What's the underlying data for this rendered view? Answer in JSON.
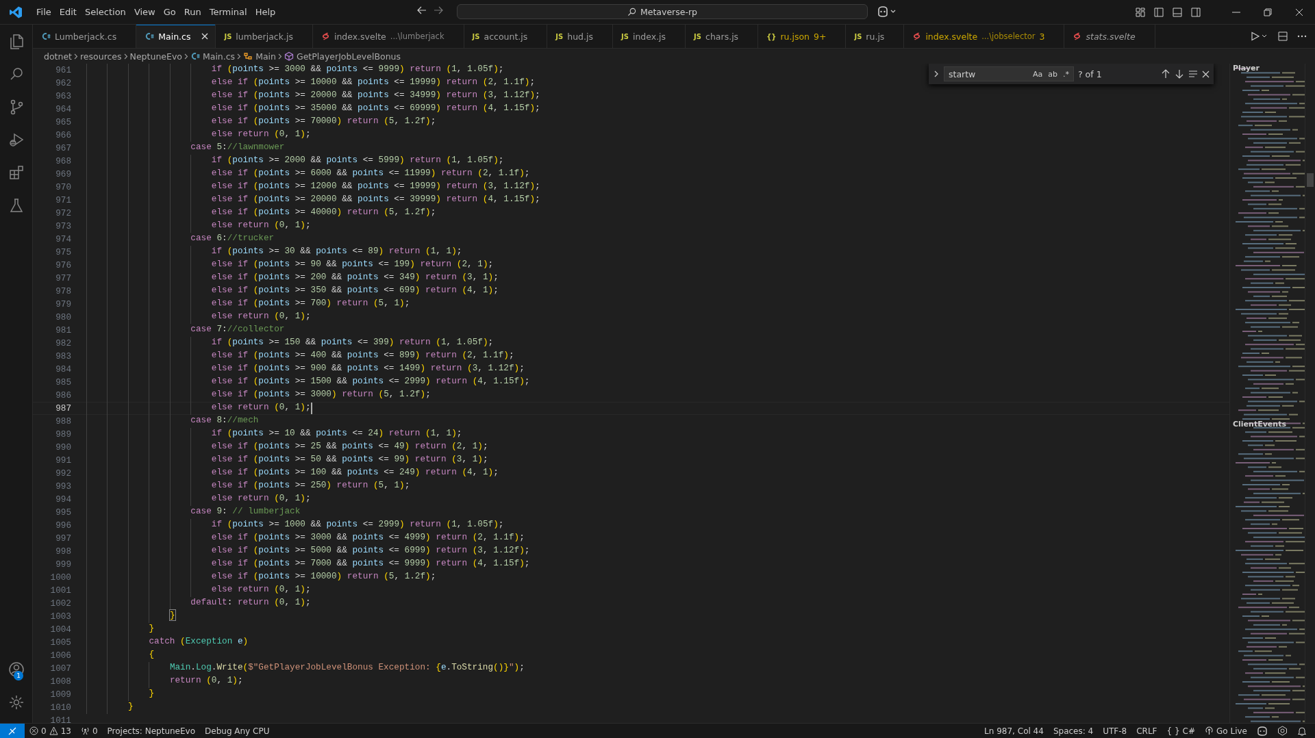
{
  "menu": [
    "File",
    "Edit",
    "Selection",
    "View",
    "Go",
    "Run",
    "Terminal",
    "Help"
  ],
  "command_center": {
    "text": "Metaverse-rp"
  },
  "activity_bar": {
    "items": [
      {
        "kind": "explorer"
      },
      {
        "kind": "search"
      },
      {
        "kind": "source-control"
      },
      {
        "kind": "run-debug"
      },
      {
        "kind": "extensions"
      },
      {
        "kind": "testing"
      }
    ],
    "account_badge": "1"
  },
  "tabs": [
    {
      "kind": "cs",
      "label": "Lumberjack.cs",
      "selected": false,
      "warning": false,
      "preview": false
    },
    {
      "kind": "cs",
      "label": "Main.cs",
      "selected": true,
      "warning": false,
      "preview": false
    },
    {
      "kind": "js",
      "icon_text": "JS",
      "label": "lumberjack.js",
      "selected": false,
      "warning": false,
      "preview": false
    },
    {
      "kind": "svelte",
      "label": "index.svelte",
      "description": "...\\lumberjack",
      "selected": false,
      "warning": false,
      "preview": false
    },
    {
      "kind": "js",
      "icon_text": "JS",
      "label": "account.js",
      "selected": false,
      "warning": false,
      "preview": false
    },
    {
      "kind": "js",
      "icon_text": "JS",
      "label": "hud.js",
      "selected": false,
      "warning": false,
      "preview": false
    },
    {
      "kind": "js",
      "icon_text": "JS",
      "label": "index.js",
      "selected": false,
      "warning": false,
      "preview": false
    },
    {
      "kind": "js",
      "icon_text": "JS",
      "label": "chars.js",
      "selected": false,
      "warning": false,
      "preview": false
    },
    {
      "kind": "json",
      "icon_text": "{}",
      "label": "ru.json",
      "badge": "9+",
      "selected": false,
      "warning": true,
      "preview": false
    },
    {
      "kind": "js",
      "icon_text": "JS",
      "label": "ru.js",
      "selected": false,
      "warning": false,
      "preview": false
    },
    {
      "kind": "svelte",
      "label": "index.svelte",
      "description": "...\\jobselector",
      "badge": "3",
      "selected": false,
      "warning": true,
      "preview": false
    },
    {
      "kind": "svelte",
      "label": "stats.svelte",
      "selected": false,
      "warning": false,
      "preview": true
    }
  ],
  "breadcrumb": [
    {
      "kind": "folder",
      "label": "dotnet"
    },
    {
      "kind": "folder",
      "label": "resources"
    },
    {
      "kind": "folder",
      "label": "NeptuneEvo"
    },
    {
      "kind": "cs",
      "label": "Main.cs"
    },
    {
      "kind": "class",
      "label": "Main"
    },
    {
      "kind": "method",
      "label": "GetPlayerJobLevelBonus"
    }
  ],
  "find": {
    "value": "startw",
    "options": [
      {
        "label": "Aa",
        "selected": false
      },
      {
        "label": "ab",
        "selected": false
      },
      {
        "label": ".*",
        "selected": false
      }
    ],
    "result": "? of 1"
  },
  "editor": {
    "lines": [
      {
        "number": "961",
        "current": false,
        "segments": [
          {
            "kind": "keyword",
            "text": "                        if"
          },
          {
            "kind": "plain",
            "text": " ("
          },
          {
            "kind": "variable",
            "text": "points"
          },
          {
            "kind": "plain",
            "text": " >= 3000 && "
          },
          {
            "kind": "variable",
            "text": "points"
          },
          {
            "kind": "plain",
            "text": " <= 9999) "
          },
          {
            "kind": "keyword",
            "text": "return"
          },
          {
            "kind": "plain",
            "text": " (1, 1.05f);"
          }
        ]
      },
      {
        "number": "962",
        "current": false,
        "segments": [
          {
            "kind": "keyword",
            "text": "                        else if"
          },
          {
            "kind": "plain",
            "text": " ("
          },
          {
            "kind": "variable",
            "text": "points"
          },
          {
            "kind": "plain",
            "text": " >= 10000 && "
          },
          {
            "kind": "variable",
            "text": "points"
          },
          {
            "kind": "plain",
            "text": " <= 19999) "
          },
          {
            "kind": "keyword",
            "text": "return"
          },
          {
            "kind": "plain",
            "text": " (2, 1.1f);"
          }
        ]
      },
      {
        "number": "963",
        "current": false,
        "segments": [
          {
            "kind": "keyword",
            "text": "                        else if"
          },
          {
            "kind": "plain",
            "text": " ("
          },
          {
            "kind": "variable",
            "text": "points"
          },
          {
            "kind": "plain",
            "text": " >= 20000 && "
          },
          {
            "kind": "variable",
            "text": "points"
          },
          {
            "kind": "plain",
            "text": " <= 34999) "
          },
          {
            "kind": "keyword",
            "text": "return"
          },
          {
            "kind": "plain",
            "text": " (3, 1.12f);"
          }
        ]
      },
      {
        "number": "964",
        "current": false,
        "segments": [
          {
            "kind": "keyword",
            "text": "                        else if"
          },
          {
            "kind": "plain",
            "text": " ("
          },
          {
            "kind": "variable",
            "text": "points"
          },
          {
            "kind": "plain",
            "text": " >= 35000 && "
          },
          {
            "kind": "variable",
            "text": "points"
          },
          {
            "kind": "plain",
            "text": " <= 69999) "
          },
          {
            "kind": "keyword",
            "text": "return"
          },
          {
            "kind": "plain",
            "text": " (4, 1.15f);"
          }
        ]
      },
      {
        "number": "965",
        "current": false,
        "segments": [
          {
            "kind": "keyword",
            "text": "                        else if"
          },
          {
            "kind": "plain",
            "text": " ("
          },
          {
            "kind": "variable",
            "text": "points"
          },
          {
            "kind": "plain",
            "text": " >= 70000) "
          },
          {
            "kind": "keyword",
            "text": "return"
          },
          {
            "kind": "plain",
            "text": " (5, 1.2f);"
          }
        ]
      },
      {
        "number": "966",
        "current": false,
        "segments": [
          {
            "kind": "keyword",
            "text": "                        else return"
          },
          {
            "kind": "plain",
            "text": " (0, 1);"
          }
        ]
      },
      {
        "number": "967",
        "current": false,
        "segments": [
          {
            "kind": "keyword",
            "text": "                    case"
          },
          {
            "kind": "plain",
            "text": " 5:"
          },
          {
            "kind": "comment",
            "text": "//lawnmower"
          }
        ]
      },
      {
        "number": "968",
        "current": false,
        "segments": [
          {
            "kind": "keyword",
            "text": "                        if"
          },
          {
            "kind": "plain",
            "text": " ("
          },
          {
            "kind": "variable",
            "text": "points"
          },
          {
            "kind": "plain",
            "text": " >= 2000 && "
          },
          {
            "kind": "variable",
            "text": "points"
          },
          {
            "kind": "plain",
            "text": " <= 5999) "
          },
          {
            "kind": "keyword",
            "text": "return"
          },
          {
            "kind": "plain",
            "text": " (1, 1.05f);"
          }
        ]
      },
      {
        "number": "969",
        "current": false,
        "segments": [
          {
            "kind": "keyword",
            "text": "                        else if"
          },
          {
            "kind": "plain",
            "text": " ("
          },
          {
            "kind": "variable",
            "text": "points"
          },
          {
            "kind": "plain",
            "text": " >= 6000 && "
          },
          {
            "kind": "variable",
            "text": "points"
          },
          {
            "kind": "plain",
            "text": " <= 11999) "
          },
          {
            "kind": "keyword",
            "text": "return"
          },
          {
            "kind": "plain",
            "text": " (2, 1.1f);"
          }
        ]
      },
      {
        "number": "970",
        "current": false,
        "segments": [
          {
            "kind": "keyword",
            "text": "                        else if"
          },
          {
            "kind": "plain",
            "text": " ("
          },
          {
            "kind": "variable",
            "text": "points"
          },
          {
            "kind": "plain",
            "text": " >= 12000 && "
          },
          {
            "kind": "variable",
            "text": "points"
          },
          {
            "kind": "plain",
            "text": " <= 19999) "
          },
          {
            "kind": "keyword",
            "text": "return"
          },
          {
            "kind": "plain",
            "text": " (3, 1.12f);"
          }
        ]
      },
      {
        "number": "971",
        "current": false,
        "segments": [
          {
            "kind": "keyword",
            "text": "                        else if"
          },
          {
            "kind": "plain",
            "text": " ("
          },
          {
            "kind": "variable",
            "text": "points"
          },
          {
            "kind": "plain",
            "text": " >= 20000 && "
          },
          {
            "kind": "variable",
            "text": "points"
          },
          {
            "kind": "plain",
            "text": " <= 39999) "
          },
          {
            "kind": "keyword",
            "text": "return"
          },
          {
            "kind": "plain",
            "text": " (4, 1.15f);"
          }
        ]
      },
      {
        "number": "972",
        "current": false,
        "segments": [
          {
            "kind": "keyword",
            "text": "                        else if"
          },
          {
            "kind": "plain",
            "text": " ("
          },
          {
            "kind": "variable",
            "text": "points"
          },
          {
            "kind": "plain",
            "text": " >= 40000) "
          },
          {
            "kind": "keyword",
            "text": "return"
          },
          {
            "kind": "plain",
            "text": " (5, 1.2f);"
          }
        ]
      },
      {
        "number": "973",
        "current": false,
        "segments": [
          {
            "kind": "keyword",
            "text": "                        else return"
          },
          {
            "kind": "plain",
            "text": " (0, 1);"
          }
        ]
      },
      {
        "number": "974",
        "current": false,
        "segments": [
          {
            "kind": "keyword",
            "text": "                    case"
          },
          {
            "kind": "plain",
            "text": " 6:"
          },
          {
            "kind": "comment",
            "text": "//trucker"
          }
        ]
      },
      {
        "number": "975",
        "current": false,
        "segments": [
          {
            "kind": "keyword",
            "text": "                        if"
          },
          {
            "kind": "plain",
            "text": " ("
          },
          {
            "kind": "variable",
            "text": "points"
          },
          {
            "kind": "plain",
            "text": " >= 30 && "
          },
          {
            "kind": "variable",
            "text": "points"
          },
          {
            "kind": "plain",
            "text": " <= 89) "
          },
          {
            "kind": "keyword",
            "text": "return"
          },
          {
            "kind": "plain",
            "text": " (1, 1);"
          }
        ]
      },
      {
        "number": "976",
        "current": false,
        "segments": [
          {
            "kind": "keyword",
            "text": "                        else if"
          },
          {
            "kind": "plain",
            "text": " ("
          },
          {
            "kind": "variable",
            "text": "points"
          },
          {
            "kind": "plain",
            "text": " >= 90 && "
          },
          {
            "kind": "variable",
            "text": "points"
          },
          {
            "kind": "plain",
            "text": " <= 199) "
          },
          {
            "kind": "keyword",
            "text": "return"
          },
          {
            "kind": "plain",
            "text": " (2, 1);"
          }
        ]
      },
      {
        "number": "977",
        "current": false,
        "segments": [
          {
            "kind": "keyword",
            "text": "                        else if"
          },
          {
            "kind": "plain",
            "text": " ("
          },
          {
            "kind": "variable",
            "text": "points"
          },
          {
            "kind": "plain",
            "text": " >= 200 && "
          },
          {
            "kind": "variable",
            "text": "points"
          },
          {
            "kind": "plain",
            "text": " <= 349) "
          },
          {
            "kind": "keyword",
            "text": "return"
          },
          {
            "kind": "plain",
            "text": " (3, 1);"
          }
        ]
      },
      {
        "number": "978",
        "current": false,
        "segments": [
          {
            "kind": "keyword",
            "text": "                        else if"
          },
          {
            "kind": "plain",
            "text": " ("
          },
          {
            "kind": "variable",
            "text": "points"
          },
          {
            "kind": "plain",
            "text": " >= 350 && "
          },
          {
            "kind": "variable",
            "text": "points"
          },
          {
            "kind": "plain",
            "text": " <= 699) "
          },
          {
            "kind": "keyword",
            "text": "return"
          },
          {
            "kind": "plain",
            "text": " (4, 1);"
          }
        ]
      },
      {
        "number": "979",
        "current": false,
        "segments": [
          {
            "kind": "keyword",
            "text": "                        else if"
          },
          {
            "kind": "plain",
            "text": " ("
          },
          {
            "kind": "variable",
            "text": "points"
          },
          {
            "kind": "plain",
            "text": " >= 700) "
          },
          {
            "kind": "keyword",
            "text": "return"
          },
          {
            "kind": "plain",
            "text": " (5, 1);"
          }
        ]
      },
      {
        "number": "980",
        "current": false,
        "segments": [
          {
            "kind": "keyword",
            "text": "                        else return"
          },
          {
            "kind": "plain",
            "text": " (0, 1);"
          }
        ]
      },
      {
        "number": "981",
        "current": false,
        "segments": [
          {
            "kind": "keyword",
            "text": "                    case"
          },
          {
            "kind": "plain",
            "text": " 7:"
          },
          {
            "kind": "comment",
            "text": "//collector"
          }
        ]
      },
      {
        "number": "982",
        "current": false,
        "segments": [
          {
            "kind": "keyword",
            "text": "                        if"
          },
          {
            "kind": "plain",
            "text": " ("
          },
          {
            "kind": "variable",
            "text": "points"
          },
          {
            "kind": "plain",
            "text": " >= 150 && "
          },
          {
            "kind": "variable",
            "text": "points"
          },
          {
            "kind": "plain",
            "text": " <= 399) "
          },
          {
            "kind": "keyword",
            "text": "return"
          },
          {
            "kind": "plain",
            "text": " (1, 1.05f);"
          }
        ]
      },
      {
        "number": "983",
        "current": false,
        "segments": [
          {
            "kind": "keyword",
            "text": "                        else if"
          },
          {
            "kind": "plain",
            "text": " ("
          },
          {
            "kind": "variable",
            "text": "points"
          },
          {
            "kind": "plain",
            "text": " >= 400 && "
          },
          {
            "kind": "variable",
            "text": "points"
          },
          {
            "kind": "plain",
            "text": " <= 899) "
          },
          {
            "kind": "keyword",
            "text": "return"
          },
          {
            "kind": "plain",
            "text": " (2, 1.1f);"
          }
        ]
      },
      {
        "number": "984",
        "current": false,
        "segments": [
          {
            "kind": "keyword",
            "text": "                        else if"
          },
          {
            "kind": "plain",
            "text": " ("
          },
          {
            "kind": "variable",
            "text": "points"
          },
          {
            "kind": "plain",
            "text": " >= 900 && "
          },
          {
            "kind": "variable",
            "text": "points"
          },
          {
            "kind": "plain",
            "text": " <= 1499) "
          },
          {
            "kind": "keyword",
            "text": "return"
          },
          {
            "kind": "plain",
            "text": " (3, 1.12f);"
          }
        ]
      },
      {
        "number": "985",
        "current": false,
        "segments": [
          {
            "kind": "keyword",
            "text": "                        else if"
          },
          {
            "kind": "plain",
            "text": " ("
          },
          {
            "kind": "variable",
            "text": "points"
          },
          {
            "kind": "plain",
            "text": " >= 1500 && "
          },
          {
            "kind": "variable",
            "text": "points"
          },
          {
            "kind": "plain",
            "text": " <= 2999) "
          },
          {
            "kind": "keyword",
            "text": "return"
          },
          {
            "kind": "plain",
            "text": " (4, 1.15f);"
          }
        ]
      },
      {
        "number": "986",
        "current": false,
        "segments": [
          {
            "kind": "keyword",
            "text": "                        else if"
          },
          {
            "kind": "plain",
            "text": " ("
          },
          {
            "kind": "variable",
            "text": "points"
          },
          {
            "kind": "plain",
            "text": " >= 3000) "
          },
          {
            "kind": "keyword",
            "text": "return"
          },
          {
            "kind": "plain",
            "text": " (5, 1.2f);"
          }
        ]
      },
      {
        "number": "987",
        "current": true,
        "segments": [
          {
            "kind": "keyword",
            "text": "                        else return"
          },
          {
            "kind": "plain",
            "text": " (0, 1);"
          }
        ]
      },
      {
        "number": "988",
        "current": false,
        "segments": [
          {
            "kind": "keyword",
            "text": "                    case"
          },
          {
            "kind": "plain",
            "text": " 8:"
          },
          {
            "kind": "comment",
            "text": "//mech"
          }
        ]
      },
      {
        "number": "989",
        "current": false,
        "segments": [
          {
            "kind": "keyword",
            "text": "                        if"
          },
          {
            "kind": "plain",
            "text": " ("
          },
          {
            "kind": "variable",
            "text": "points"
          },
          {
            "kind": "plain",
            "text": " >= 10 && "
          },
          {
            "kind": "variable",
            "text": "points"
          },
          {
            "kind": "plain",
            "text": " <= 24) "
          },
          {
            "kind": "keyword",
            "text": "return"
          },
          {
            "kind": "plain",
            "text": " (1, 1);"
          }
        ]
      },
      {
        "number": "990",
        "current": false,
        "segments": [
          {
            "kind": "keyword",
            "text": "                        else if"
          },
          {
            "kind": "plain",
            "text": " ("
          },
          {
            "kind": "variable",
            "text": "points"
          },
          {
            "kind": "plain",
            "text": " >= 25 && "
          },
          {
            "kind": "variable",
            "text": "points"
          },
          {
            "kind": "plain",
            "text": " <= 49) "
          },
          {
            "kind": "keyword",
            "text": "return"
          },
          {
            "kind": "plain",
            "text": " (2, 1);"
          }
        ]
      },
      {
        "number": "991",
        "current": false,
        "segments": [
          {
            "kind": "keyword",
            "text": "                        else if"
          },
          {
            "kind": "plain",
            "text": " ("
          },
          {
            "kind": "variable",
            "text": "points"
          },
          {
            "kind": "plain",
            "text": " >= 50 && "
          },
          {
            "kind": "variable",
            "text": "points"
          },
          {
            "kind": "plain",
            "text": " <= 99) "
          },
          {
            "kind": "keyword",
            "text": "return"
          },
          {
            "kind": "plain",
            "text": " (3, 1);"
          }
        ]
      },
      {
        "number": "992",
        "current": false,
        "segments": [
          {
            "kind": "keyword",
            "text": "                        else if"
          },
          {
            "kind": "plain",
            "text": " ("
          },
          {
            "kind": "variable",
            "text": "points"
          },
          {
            "kind": "plain",
            "text": " >= 100 && "
          },
          {
            "kind": "variable",
            "text": "points"
          },
          {
            "kind": "plain",
            "text": " <= 249) "
          },
          {
            "kind": "keyword",
            "text": "return"
          },
          {
            "kind": "plain",
            "text": " (4, 1);"
          }
        ]
      },
      {
        "number": "993",
        "current": false,
        "segments": [
          {
            "kind": "keyword",
            "text": "                        else if"
          },
          {
            "kind": "plain",
            "text": " ("
          },
          {
            "kind": "variable",
            "text": "points"
          },
          {
            "kind": "plain",
            "text": " >= 250) "
          },
          {
            "kind": "keyword",
            "text": "return"
          },
          {
            "kind": "plain",
            "text": " (5, 1);"
          }
        ]
      },
      {
        "number": "994",
        "current": false,
        "segments": [
          {
            "kind": "keyword",
            "text": "                        else return"
          },
          {
            "kind": "plain",
            "text": " (0, 1);"
          }
        ]
      },
      {
        "number": "995",
        "current": false,
        "segments": [
          {
            "kind": "keyword",
            "text": "                    case"
          },
          {
            "kind": "plain",
            "text": " 9: "
          },
          {
            "kind": "comment",
            "text": "// lumberjack"
          }
        ]
      },
      {
        "number": "996",
        "current": false,
        "segments": [
          {
            "kind": "keyword",
            "text": "                        if"
          },
          {
            "kind": "plain",
            "text": " ("
          },
          {
            "kind": "variable",
            "text": "points"
          },
          {
            "kind": "plain",
            "text": " >= 1000 && "
          },
          {
            "kind": "variable",
            "text": "points"
          },
          {
            "kind": "plain",
            "text": " <= 2999) "
          },
          {
            "kind": "keyword",
            "text": "return"
          },
          {
            "kind": "plain",
            "text": " (1, 1.05f);"
          }
        ]
      },
      {
        "number": "997",
        "current": false,
        "segments": [
          {
            "kind": "keyword",
            "text": "                        else if"
          },
          {
            "kind": "plain",
            "text": " ("
          },
          {
            "kind": "variable",
            "text": "points"
          },
          {
            "kind": "plain",
            "text": " >= 3000 && "
          },
          {
            "kind": "variable",
            "text": "points"
          },
          {
            "kind": "plain",
            "text": " <= 4999) "
          },
          {
            "kind": "keyword",
            "text": "return"
          },
          {
            "kind": "plain",
            "text": " (2, 1.1f);"
          }
        ]
      },
      {
        "number": "998",
        "current": false,
        "segments": [
          {
            "kind": "keyword",
            "text": "                        else if"
          },
          {
            "kind": "plain",
            "text": " ("
          },
          {
            "kind": "variable",
            "text": "points"
          },
          {
            "kind": "plain",
            "text": " >= 5000 && "
          },
          {
            "kind": "variable",
            "text": "points"
          },
          {
            "kind": "plain",
            "text": " <= 6999) "
          },
          {
            "kind": "keyword",
            "text": "return"
          },
          {
            "kind": "plain",
            "text": " (3, 1.12f);"
          }
        ]
      },
      {
        "number": "999",
        "current": false,
        "segments": [
          {
            "kind": "keyword",
            "text": "                        else if"
          },
          {
            "kind": "plain",
            "text": " ("
          },
          {
            "kind": "variable",
            "text": "points"
          },
          {
            "kind": "plain",
            "text": " >= 7000 && "
          },
          {
            "kind": "variable",
            "text": "points"
          },
          {
            "kind": "plain",
            "text": " <= 9999) "
          },
          {
            "kind": "keyword",
            "text": "return"
          },
          {
            "kind": "plain",
            "text": " (4, 1.15f);"
          }
        ]
      },
      {
        "number": "1000",
        "current": false,
        "segments": [
          {
            "kind": "keyword",
            "text": "                        else if"
          },
          {
            "kind": "plain",
            "text": " ("
          },
          {
            "kind": "variable",
            "text": "points"
          },
          {
            "kind": "plain",
            "text": " >= 10000) "
          },
          {
            "kind": "keyword",
            "text": "return"
          },
          {
            "kind": "plain",
            "text": " (5, 1.2f);"
          }
        ]
      },
      {
        "number": "1001",
        "current": false,
        "segments": [
          {
            "kind": "keyword",
            "text": "                        else return"
          },
          {
            "kind": "plain",
            "text": " (0, 1);"
          }
        ]
      },
      {
        "number": "1002",
        "current": false,
        "segments": [
          {
            "kind": "keyword",
            "text": "                    default"
          },
          {
            "kind": "plain",
            "text": ": "
          },
          {
            "kind": "keyword",
            "text": "return"
          },
          {
            "kind": "plain",
            "text": " (0, 1);"
          }
        ]
      },
      {
        "number": "1003",
        "current": false,
        "segments": [
          {
            "kind": "bracket-match",
            "text": "                }"
          }
        ]
      },
      {
        "number": "1004",
        "current": false,
        "segments": [
          {
            "kind": "plain",
            "text": "            }"
          }
        ]
      },
      {
        "number": "1005",
        "current": false,
        "segments": [
          {
            "kind": "keyword",
            "text": "            catch"
          },
          {
            "kind": "plain",
            "text": " ("
          },
          {
            "kind": "type",
            "text": "Exception "
          },
          {
            "kind": "variable",
            "text": "e"
          },
          {
            "kind": "plain",
            "text": ")"
          }
        ]
      },
      {
        "number": "1006",
        "current": false,
        "segments": [
          {
            "kind": "plain",
            "text": "            {"
          }
        ]
      },
      {
        "number": "1007",
        "current": false,
        "segments": [
          {
            "kind": "type",
            "text": "                Main"
          },
          {
            "kind": "plain",
            "text": "."
          },
          {
            "kind": "type",
            "text": "Log"
          },
          {
            "kind": "plain",
            "text": "."
          },
          {
            "kind": "function",
            "text": "Write"
          },
          {
            "kind": "plain",
            "text": "("
          },
          {
            "kind": "string",
            "text": "$\"GetPlayerJobLevelBonus Exception: "
          },
          {
            "kind": "plain",
            "text": "{"
          },
          {
            "kind": "variable",
            "text": "e"
          },
          {
            "kind": "plain",
            "text": "."
          },
          {
            "kind": "function",
            "text": "ToString"
          },
          {
            "kind": "plain",
            "text": "()}"
          },
          {
            "kind": "string",
            "text": "\""
          },
          {
            "kind": "plain",
            "text": ");"
          }
        ]
      },
      {
        "number": "1008",
        "current": false,
        "segments": [
          {
            "kind": "keyword",
            "text": "                return"
          },
          {
            "kind": "plain",
            "text": " (0, 1);"
          }
        ]
      },
      {
        "number": "1009",
        "current": false,
        "segments": [
          {
            "kind": "plain",
            "text": "            }"
          }
        ]
      },
      {
        "number": "1010",
        "current": false,
        "segments": [
          {
            "kind": "plain",
            "text": "        }"
          }
        ]
      },
      {
        "number": "1011",
        "current": false
      }
    ]
  },
  "minimap": {
    "labels": [
      "Player",
      "ClientEvents"
    ]
  },
  "status_bar": {
    "errors": "0",
    "warnings": "13",
    "ports": "0",
    "left": [
      "Projects: NeptuneEvo",
      "Debug Any CPU"
    ],
    "position": "Ln 987, Col 44",
    "right": [
      "Spaces: 4",
      "UTF-8",
      "CRLF"
    ],
    "language_icon": "{ }",
    "language": "C#",
    "go_live": "Go Live"
  }
}
